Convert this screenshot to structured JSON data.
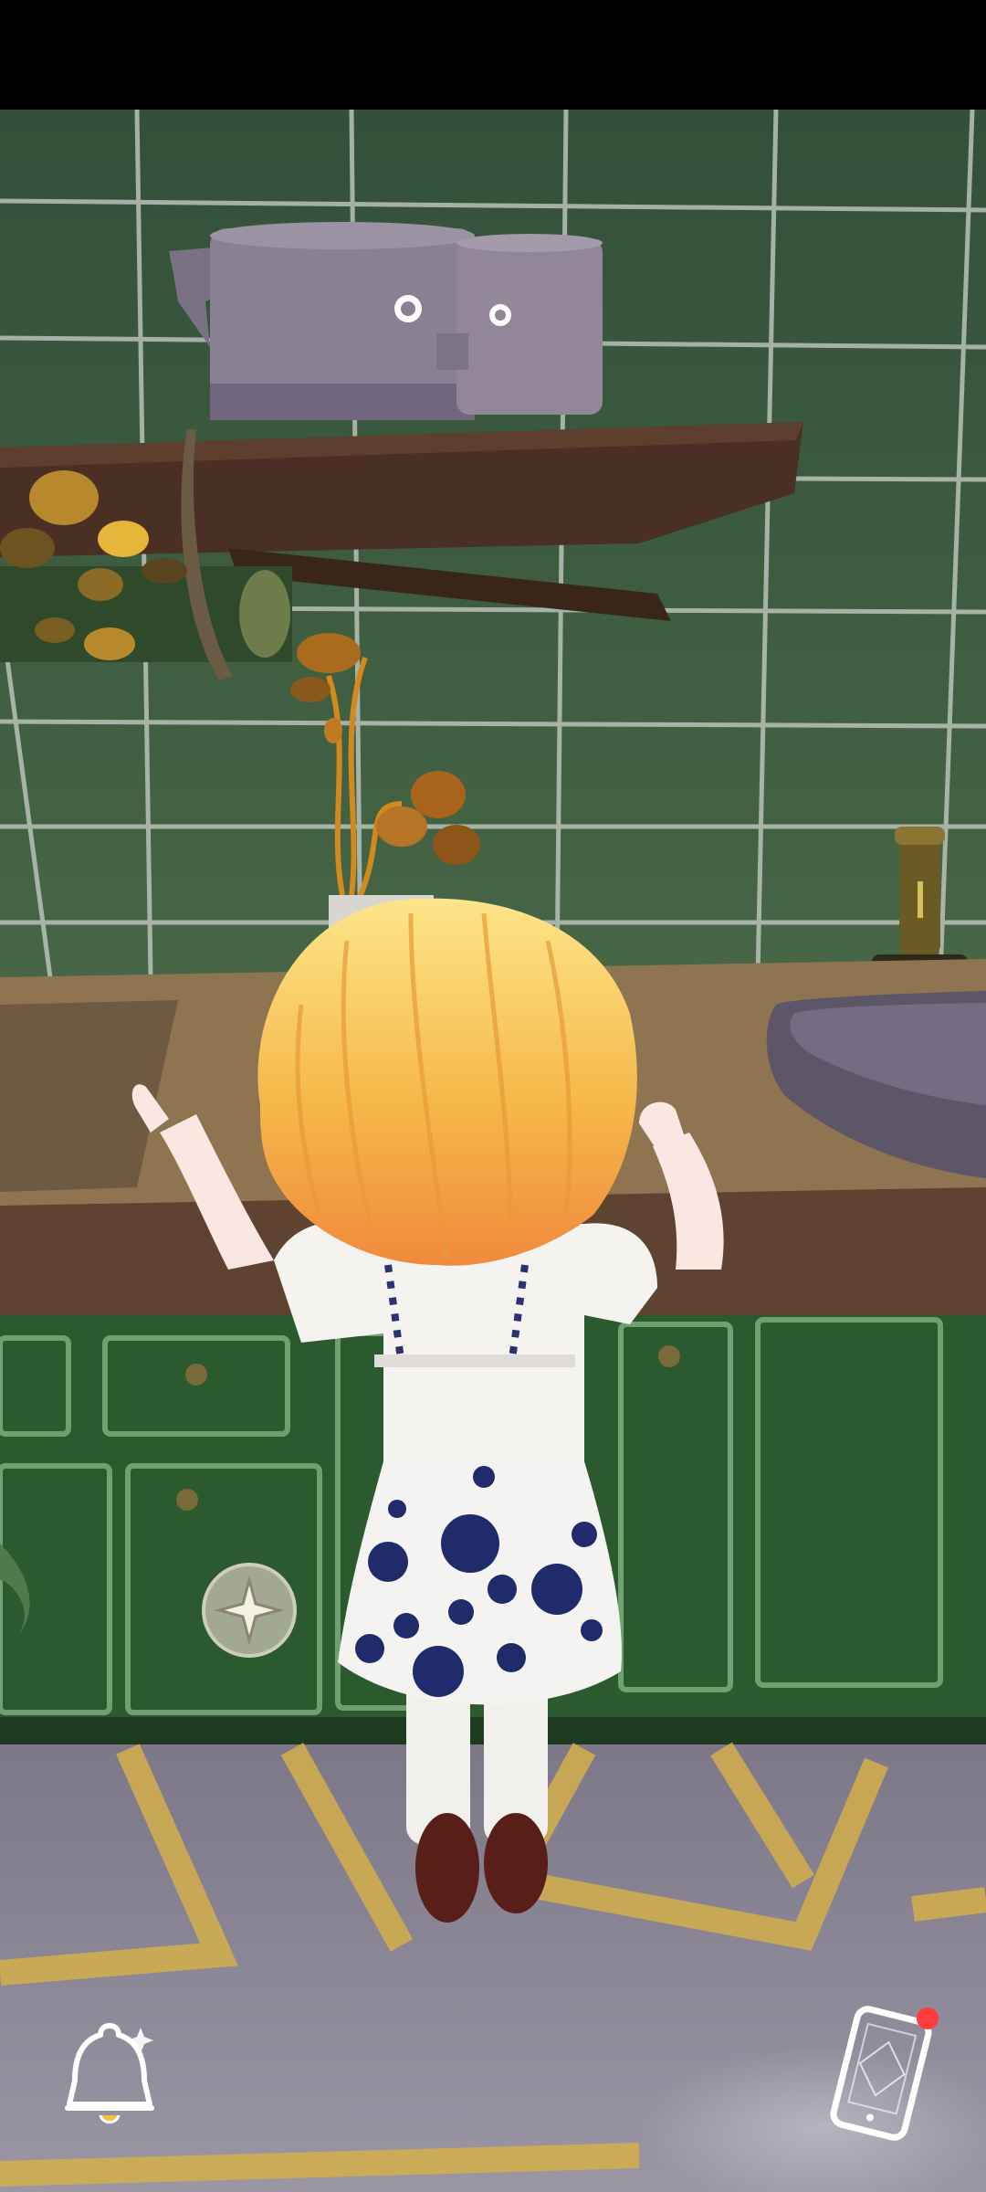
{
  "scene": {
    "name": "kitchen-counter",
    "colors": {
      "status_bar": "#000000",
      "tile": "#3c5a3c",
      "grout": "#b8c0b8",
      "counter_top": "#8a7148",
      "cabinet": "#2e5a30",
      "floor": "#8a8593",
      "floor_lines": "#d2b04c",
      "sink": "#5b5468",
      "pot": "#7a7080",
      "hair": "#f4c34a",
      "dress_dot": "#1f2b6a"
    }
  },
  "hud": {
    "bell_icon": "bell-icon",
    "phone_icon": "phone-icon",
    "notification_dot_color": "#ff3b3b",
    "joystick_icon": "compass-star-icon"
  }
}
